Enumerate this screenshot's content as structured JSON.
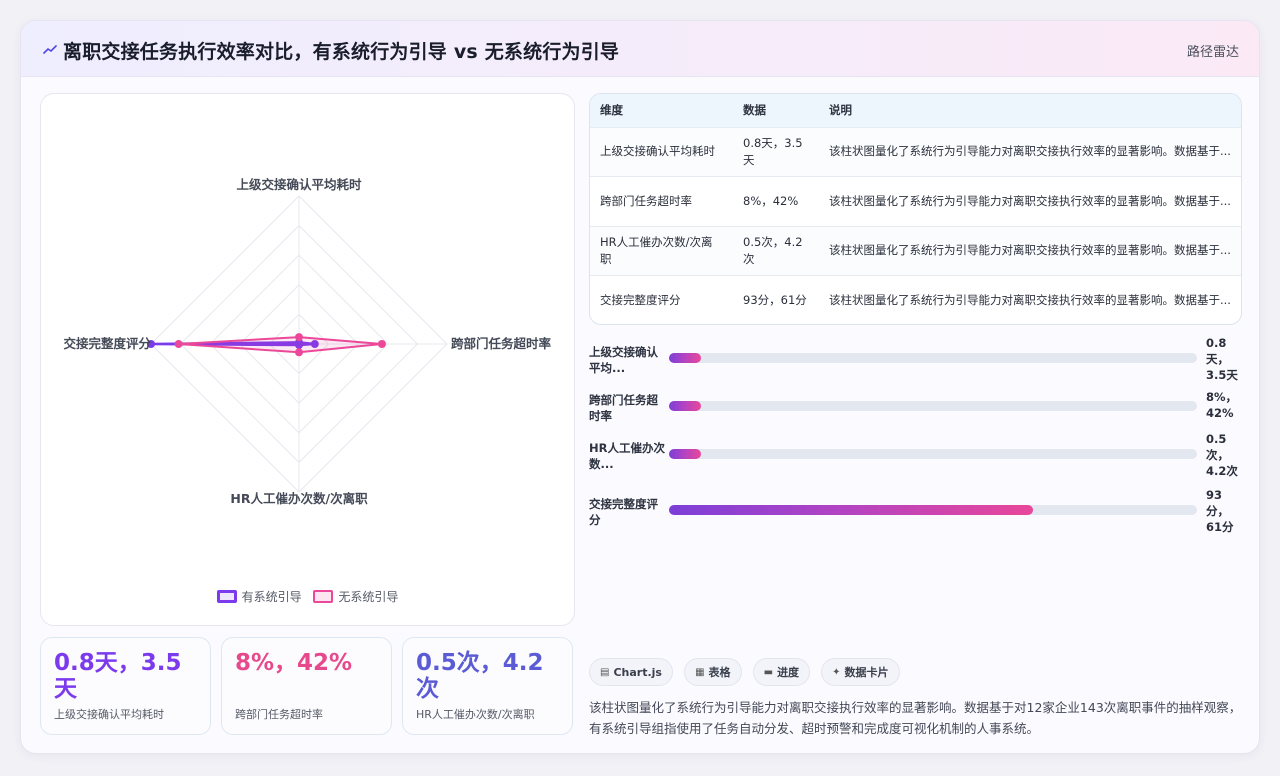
{
  "header": {
    "title": "离职交接任务执行效率对比，有系统行为引导 vs 无系统行为引导",
    "mode": "路径雷达"
  },
  "colors": {
    "guided": "#7c3aed",
    "unguided": "#ec4899",
    "stat_1": "#7c3aed",
    "stat_2": "#e64a8c",
    "stat_3": "#5b5bd6"
  },
  "radar": {
    "axes": [
      "上级交接确认平均耗时",
      "跨部门任务超时率",
      "HR人工催办次数/次离职",
      "交接完整度评分"
    ],
    "legend": [
      "有系统引导",
      "无系统引导"
    ]
  },
  "chart_data": {
    "type": "radar",
    "categories": [
      "上级交接确认平均耗时",
      "跨部门任务超时率",
      "HR人工催办次数/次离职",
      "交接完整度评分"
    ],
    "series": [
      {
        "name": "有系统引导",
        "values": [
          0.8,
          8,
          0.5,
          93
        ]
      },
      {
        "name": "无系统引导",
        "values": [
          3.5,
          42,
          4.2,
          61
        ]
      }
    ],
    "rlim": [
      0,
      75
    ]
  },
  "stats": [
    {
      "value": "0.8天，3.5天",
      "label": "上级交接确认平均耗时"
    },
    {
      "value": "8%，42%",
      "label": "跨部门任务超时率"
    },
    {
      "value": "0.5次，4.2次",
      "label": "HR人工催办次数/次离职"
    }
  ],
  "table": {
    "headers": [
      "维度",
      "数据",
      "说明"
    ],
    "rows": [
      {
        "dim": "上级交接确认平均耗时",
        "data": "0.8天，3.5天",
        "note": "该柱状图量化了系统行为引导能力对离职交接执行效率的显著影响。数据基于..."
      },
      {
        "dim": "跨部门任务超时率",
        "data": "8%，42%",
        "note": "该柱状图量化了系统行为引导能力对离职交接执行效率的显著影响。数据基于..."
      },
      {
        "dim": "HR人工催办次数/次离职",
        "data": "0.5次，4.2次",
        "note": "该柱状图量化了系统行为引导能力对离职交接执行效率的显著影响。数据基于..."
      },
      {
        "dim": "交接完整度评分",
        "data": "93分，61分",
        "note": "该柱状图量化了系统行为引导能力对离职交接执行效率的显著影响。数据基于..."
      }
    ]
  },
  "progress": [
    {
      "label": "上级交接确认平均...",
      "value": "0.8天，3.5天",
      "fraction": 0.06
    },
    {
      "label": "跨部门任务超时率",
      "value": "8%，42%",
      "fraction": 0.06
    },
    {
      "label": "HR人工催办次数...",
      "value": "0.5次，4.2次",
      "fraction": 0.06
    },
    {
      "label": "交接完整度评分",
      "value": "93分，61分",
      "fraction": 0.69
    }
  ],
  "chips": [
    {
      "icon": "chart-icon",
      "glyph": "▤",
      "label": "Chart.js"
    },
    {
      "icon": "table-icon",
      "glyph": "▦",
      "label": "表格"
    },
    {
      "icon": "progress-icon",
      "glyph": "▬",
      "label": "进度"
    },
    {
      "icon": "sparkle-icon",
      "glyph": "✦",
      "label": "数据卡片"
    }
  ],
  "description": "该柱状图量化了系统行为引导能力对离职交接执行效率的显著影响。数据基于对12家企业143次离职事件的抽样观察，有系统引导组指使用了任务自动分发、超时预警和完成度可视化机制的人事系统。"
}
